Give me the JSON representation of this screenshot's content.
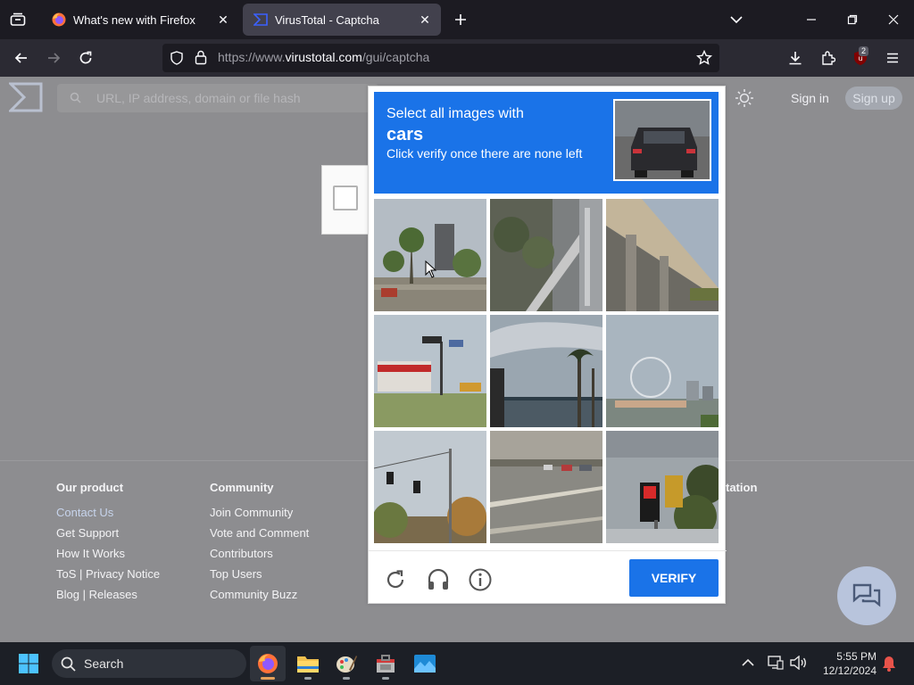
{
  "browser": {
    "tabs": [
      {
        "title": "What's new with Firefox",
        "active": false
      },
      {
        "title": "VirusTotal - Captcha",
        "active": true
      }
    ],
    "url_prefix": "https://www.",
    "url_domain": "virustotal.com",
    "url_path": "/gui/captcha",
    "extension_badge": "2"
  },
  "site": {
    "search_placeholder": "URL, IP address, domain or file hash",
    "sign_in": "Sign in",
    "sign_up": "Sign up"
  },
  "captcha": {
    "prompt_line1": "Select all images with",
    "prompt_target": "cars",
    "prompt_line3": "Click verify once there are none left",
    "verify_label": "VERIFY",
    "tiles": [
      "palm-trees-street",
      "stairs-building",
      "overpass-bridge",
      "gas-station-sign",
      "palm-trees-sky",
      "ferris-wheel-city",
      "traffic-light-trees",
      "road-with-cars",
      "pedestrian-signal"
    ]
  },
  "footer": {
    "columns": [
      {
        "heading": "Our product",
        "links": [
          "Contact Us",
          "Get Support",
          "How It Works",
          "ToS | Privacy Notice",
          "Blog | Releases"
        ]
      },
      {
        "heading": "Community",
        "links": [
          "Join Community",
          "Vote and Comment",
          "Contributors",
          "Top Users",
          "Community Buzz"
        ]
      }
    ],
    "partial_heading": "tation"
  },
  "taskbar": {
    "search_label": "Search",
    "time": "5:55 PM",
    "date": "12/12/2024"
  },
  "colors": {
    "accent": "#1a73e8",
    "page_overlay": "#8d8d90"
  }
}
